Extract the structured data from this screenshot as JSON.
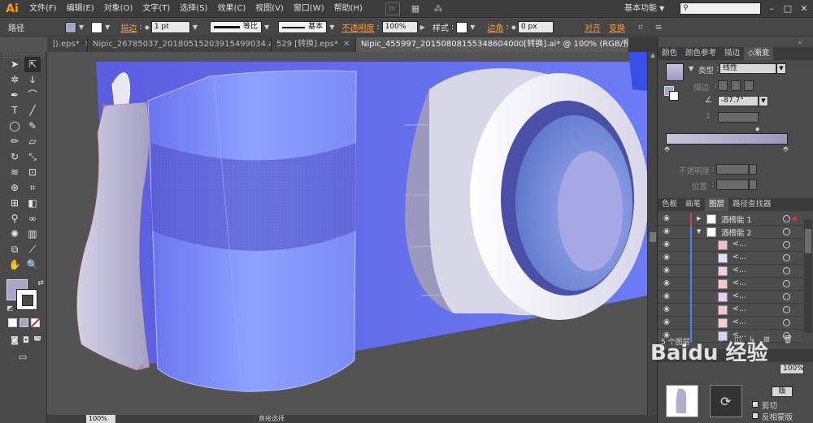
{
  "app": {
    "logo": "Ai",
    "menus": [
      "文件(F)",
      "编辑(E)",
      "对象(O)",
      "文字(T)",
      "选择(S)",
      "效果(C)",
      "视图(V)",
      "窗口(W)",
      "帮助(H)"
    ],
    "bridge_label": "Br",
    "workspace": "基本功能",
    "accent_color": "#ff9a00"
  },
  "control_bar": {
    "object_type": "路径",
    "fill_color": "#a8a6c6",
    "stroke_label": "描边",
    "stroke_weight": "1 pt",
    "profile_label": "等比",
    "brush_label": "基本",
    "opacity_label": "不透明度",
    "opacity_value": "100%",
    "style_label": "样式",
    "corner_label": "边角",
    "corner_value": "0 px",
    "align_label": "对齐",
    "transform_label": "变换"
  },
  "tabs": [
    {
      "label": "]).eps*",
      "active": false
    },
    {
      "label": "Nipic_26785037_20180515203915499034.ai*",
      "active": false
    },
    {
      "label": "529 [转换].eps*",
      "active": false
    },
    {
      "label": "Nipic_455997_20150808155348604000[转换].ai* @ 100% (RGB/预览)",
      "active": true
    }
  ],
  "status_bar": {
    "zoom": "100%",
    "mode": "直接选择"
  },
  "gradient_panel": {
    "tabs": [
      "颜色",
      "颜色参考",
      "描边",
      "渐变"
    ],
    "type_label": "类型",
    "type_value": "线性",
    "stroke_label": "描边",
    "angle_value": "-87.7°",
    "opacity_label": "不透明度",
    "position_label": "位置",
    "gradient_start": "#c7c5dd",
    "gradient_end": "#9b98bd"
  },
  "layers_panel": {
    "tabs": [
      "色板",
      "画笔",
      "图层",
      "路径查找器"
    ],
    "layers": [
      {
        "name": "酒榜能 1",
        "expanded": false,
        "indent": 0,
        "bar_color": "#e04040",
        "selected": true
      },
      {
        "name": "酒榜能 2",
        "expanded": true,
        "indent": 0,
        "bar_color": "#4a7cff",
        "selected": false
      },
      {
        "name": "<...",
        "indent": 1,
        "bar_color": "#4a7cff",
        "selected": false
      },
      {
        "name": "<...",
        "indent": 1,
        "bar_color": "#4a7cff",
        "selected": false
      },
      {
        "name": "<...",
        "indent": 1,
        "bar_color": "#4a7cff",
        "selected": false
      },
      {
        "name": "<...",
        "indent": 1,
        "bar_color": "#4a7cff",
        "selected": false
      },
      {
        "name": "<...",
        "indent": 1,
        "bar_color": "#4a7cff",
        "selected": false
      },
      {
        "name": "<...",
        "indent": 1,
        "bar_color": "#4a7cff",
        "selected": false
      },
      {
        "name": "<...",
        "indent": 1,
        "bar_color": "#4a7cff",
        "selected": false
      },
      {
        "name": "<...",
        "indent": 1,
        "bar_color": "#4a7cff",
        "selected": false
      }
    ],
    "count_label": "5 个图层"
  },
  "lower_panel": {
    "opacity_value": "100%",
    "clip_label": "剪切",
    "invert_label": "反相蒙版",
    "make_label": "版"
  },
  "watermark": "Baidu 经验"
}
